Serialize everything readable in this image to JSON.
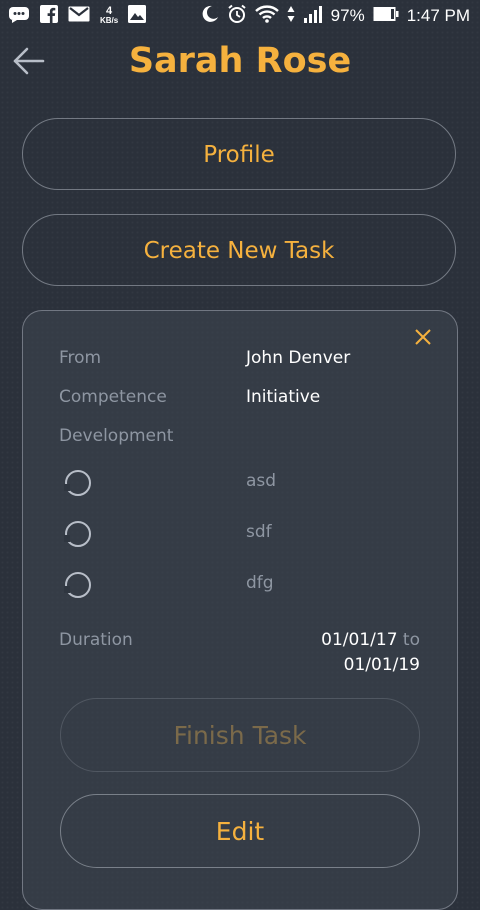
{
  "status_bar": {
    "speed_value": "4",
    "speed_unit": "KB/s",
    "battery": "97%",
    "time": "1:47 PM"
  },
  "header": {
    "title": "Sarah Rose"
  },
  "actions": {
    "profile_label": "Profile",
    "create_task_label": "Create New Task"
  },
  "task": {
    "from_label": "From",
    "from_value": "John Denver",
    "competence_label": "Competence",
    "competence_value": "Initiative",
    "development_label": "Development",
    "development_items": [
      "asd",
      "sdf",
      "dfg"
    ],
    "duration_label": "Duration",
    "duration_start": "01/01/17",
    "duration_to": "to",
    "duration_end": "01/01/19",
    "finish_label": "Finish Task",
    "edit_label": "Edit"
  },
  "colors": {
    "accent": "#f5b13e",
    "background": "#2b313b",
    "muted_text": "#8e96a2"
  }
}
